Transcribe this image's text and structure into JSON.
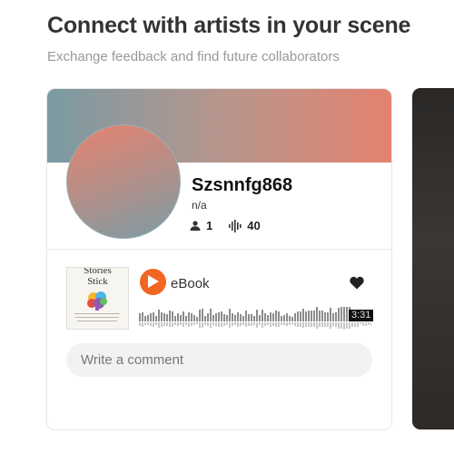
{
  "header": {
    "title": "Connect with artists in your scene",
    "subtitle": "Exchange feedback and find future collaborators"
  },
  "artist_card": {
    "username": "Szsnnfg868",
    "location": "n/a",
    "stats": {
      "followers": "1",
      "tracks": "40"
    },
    "track": {
      "artwork_title_line1": "Stories",
      "artwork_title_line2": "Stick",
      "title": "eBook",
      "duration": "3:31",
      "accent_color": "#f26522"
    },
    "comment": {
      "placeholder": "Write a comment"
    }
  }
}
